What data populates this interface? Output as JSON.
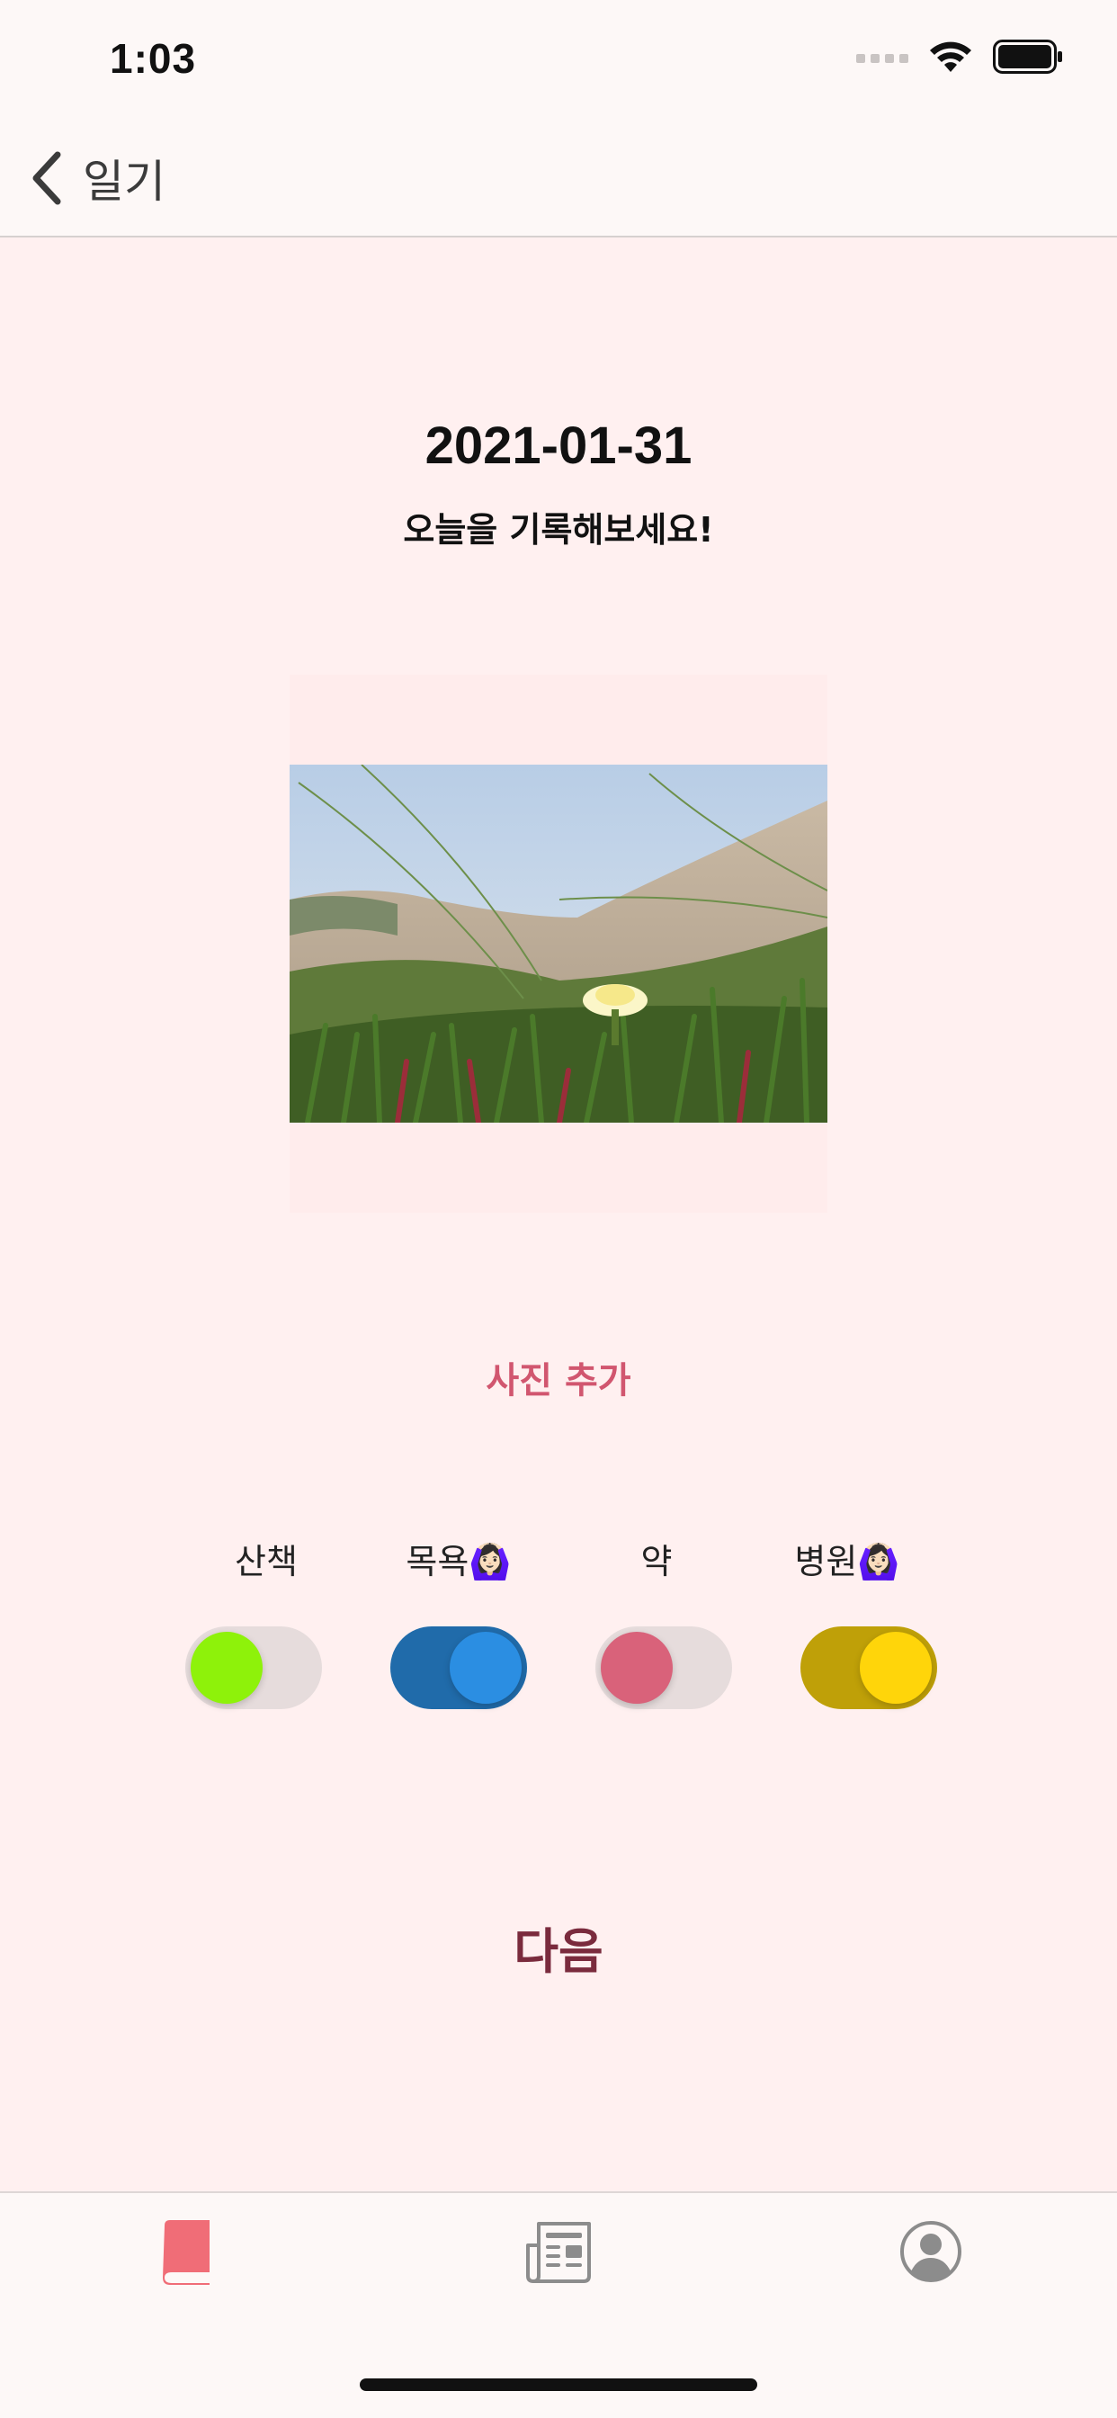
{
  "status_bar": {
    "time": "1:03"
  },
  "nav": {
    "back_label": "일기"
  },
  "header": {
    "date": "2021-01-31",
    "subtitle": "오늘을 기록해보세요!"
  },
  "photo": {
    "description_icon": "flower-photo"
  },
  "actions": {
    "add_photo_label": "사진 추가",
    "next_label": "다음"
  },
  "toggles": [
    {
      "label": "산책",
      "on": false,
      "color": "#8ef20a"
    },
    {
      "label": "목욕🙆🏻‍♀️",
      "on": true,
      "color": "#2b8ee2"
    },
    {
      "label": "약",
      "on": false,
      "color": "#d9627a"
    },
    {
      "label": "병원🙆🏻‍♀️",
      "on": true,
      "color": "#ffd50a"
    }
  ],
  "tabbar": {
    "tabs": [
      {
        "name": "diary",
        "icon": "book-icon",
        "active": true,
        "color": "#f06d77"
      },
      {
        "name": "feed",
        "icon": "newspaper-icon",
        "active": false,
        "color": "#8c8c8c"
      },
      {
        "name": "profile",
        "icon": "person-circle-icon",
        "active": false,
        "color": "#8c8c8c"
      }
    ]
  }
}
